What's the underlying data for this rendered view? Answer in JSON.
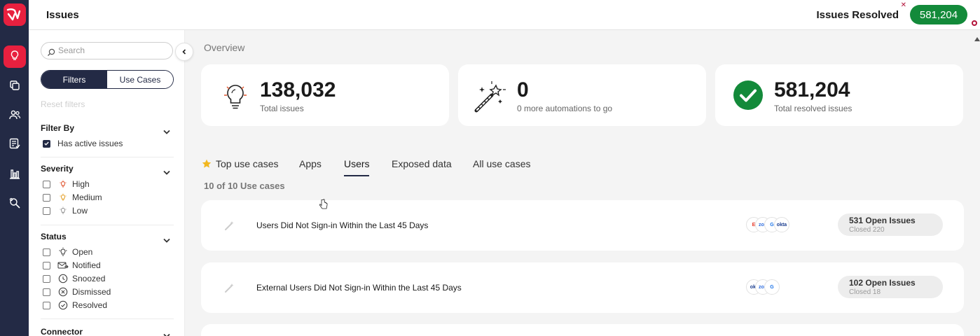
{
  "header": {
    "title": "Issues",
    "resolved_label": "Issues Resolved",
    "resolved_value": "581,204"
  },
  "sidebar_nav": [
    {
      "icon": "logo-icon"
    },
    {
      "icon": "lightbulb-icon",
      "active": true
    },
    {
      "icon": "copy-icon"
    },
    {
      "icon": "users-icon"
    },
    {
      "icon": "list-check-icon"
    },
    {
      "icon": "bar-chart-icon"
    },
    {
      "icon": "search-magnify-icon"
    }
  ],
  "filters": {
    "search_placeholder": "Search",
    "segment": {
      "filters": "Filters",
      "use_cases": "Use Cases"
    },
    "reset": "Reset filters",
    "filter_by": {
      "title": "Filter By",
      "options": [
        {
          "label": "Has active issues",
          "checked": true
        }
      ]
    },
    "severity": {
      "title": "Severity",
      "options": [
        {
          "label": "High"
        },
        {
          "label": "Medium"
        },
        {
          "label": "Low"
        }
      ]
    },
    "status": {
      "title": "Status",
      "options": [
        {
          "label": "Open"
        },
        {
          "label": "Notified"
        },
        {
          "label": "Snoozed"
        },
        {
          "label": "Dismissed"
        },
        {
          "label": "Resolved"
        }
      ]
    },
    "connector": {
      "title": "Connector"
    }
  },
  "overview": {
    "title": "Overview",
    "cards": [
      {
        "value": "138,032",
        "label": "Total issues"
      },
      {
        "value": "0",
        "label": "0 more automations to go"
      },
      {
        "value": "581,204",
        "label": "Total resolved issues"
      }
    ]
  },
  "tabs": [
    {
      "label": "Top use cases"
    },
    {
      "label": "Apps"
    },
    {
      "label": "Users",
      "active": true
    },
    {
      "label": "Exposed data"
    },
    {
      "label": "All use cases"
    }
  ],
  "use_case_count": "10 of 10 Use cases",
  "use_cases": [
    {
      "title": "Users Did Not Sign-in Within the Last 45 Days",
      "apps": [
        "E",
        "zoo",
        "G",
        "okta"
      ],
      "open": "531 Open Issues",
      "closed": "Closed 220"
    },
    {
      "title": "External Users Did Not Sign-in Within the Last 45 Days",
      "apps": [
        "okt",
        "zoo",
        "G"
      ],
      "open": "102 Open Issues",
      "closed": "Closed 18"
    }
  ],
  "colors": {
    "brand": "#e8203f",
    "navy": "#232a45",
    "success": "#138a3a"
  }
}
